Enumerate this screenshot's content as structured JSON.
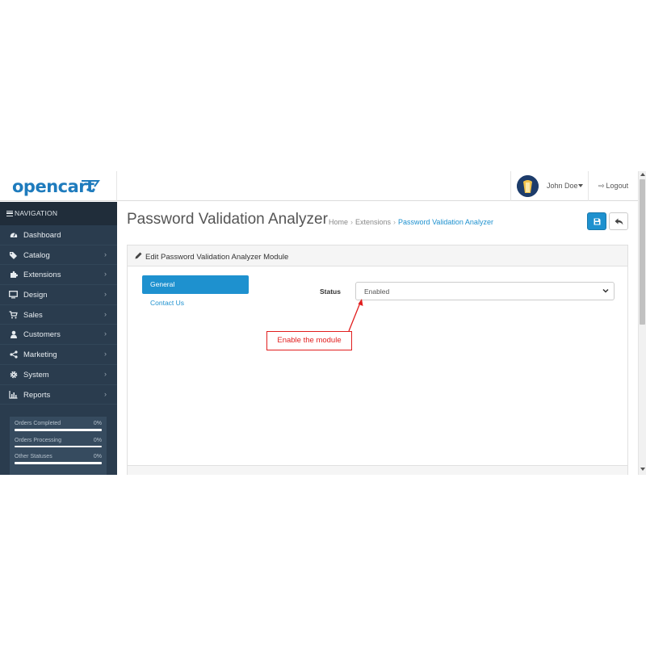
{
  "app": {
    "logo_text": "opencart"
  },
  "header": {
    "user_name": "John Doe",
    "logout_label": "Logout",
    "logout_icon": "sign-out-icon"
  },
  "sidebar": {
    "nav_title": "NAVIGATION",
    "items": [
      {
        "label": "Dashboard",
        "icon": "dashboard-icon",
        "has_arrow": false
      },
      {
        "label": "Catalog",
        "icon": "tags-icon",
        "has_arrow": true
      },
      {
        "label": "Extensions",
        "icon": "puzzle-icon",
        "has_arrow": true
      },
      {
        "label": "Design",
        "icon": "monitor-icon",
        "has_arrow": true
      },
      {
        "label": "Sales",
        "icon": "cart-icon",
        "has_arrow": true
      },
      {
        "label": "Customers",
        "icon": "user-icon",
        "has_arrow": true
      },
      {
        "label": "Marketing",
        "icon": "share-icon",
        "has_arrow": true
      },
      {
        "label": "System",
        "icon": "gear-icon",
        "has_arrow": true
      },
      {
        "label": "Reports",
        "icon": "bar-chart-icon",
        "has_arrow": true
      }
    ],
    "stats": [
      {
        "label": "Orders Completed",
        "value": "0%"
      },
      {
        "label": "Orders Processing",
        "value": "0%"
      },
      {
        "label": "Other Statuses",
        "value": "0%"
      }
    ]
  },
  "page": {
    "title": "Password Validation Analyzer",
    "breadcrumb": [
      "Home",
      "Extensions",
      "Password Validation Analyzer"
    ],
    "panel_title": "Edit Password Validation Analyzer Module",
    "tabs": [
      {
        "label": "General",
        "active": true
      },
      {
        "label": "Contact Us",
        "active": false
      }
    ],
    "status_label": "Status",
    "status_value": "Enabled"
  },
  "annotation": {
    "text": "Enable the module",
    "color": "#e11e1e"
  },
  "colors": {
    "primary": "#1e91cf",
    "sidebar_bg": "#2a3c4e",
    "sidebar_header_bg": "#202d3a",
    "logo": "#1e7bbd"
  }
}
